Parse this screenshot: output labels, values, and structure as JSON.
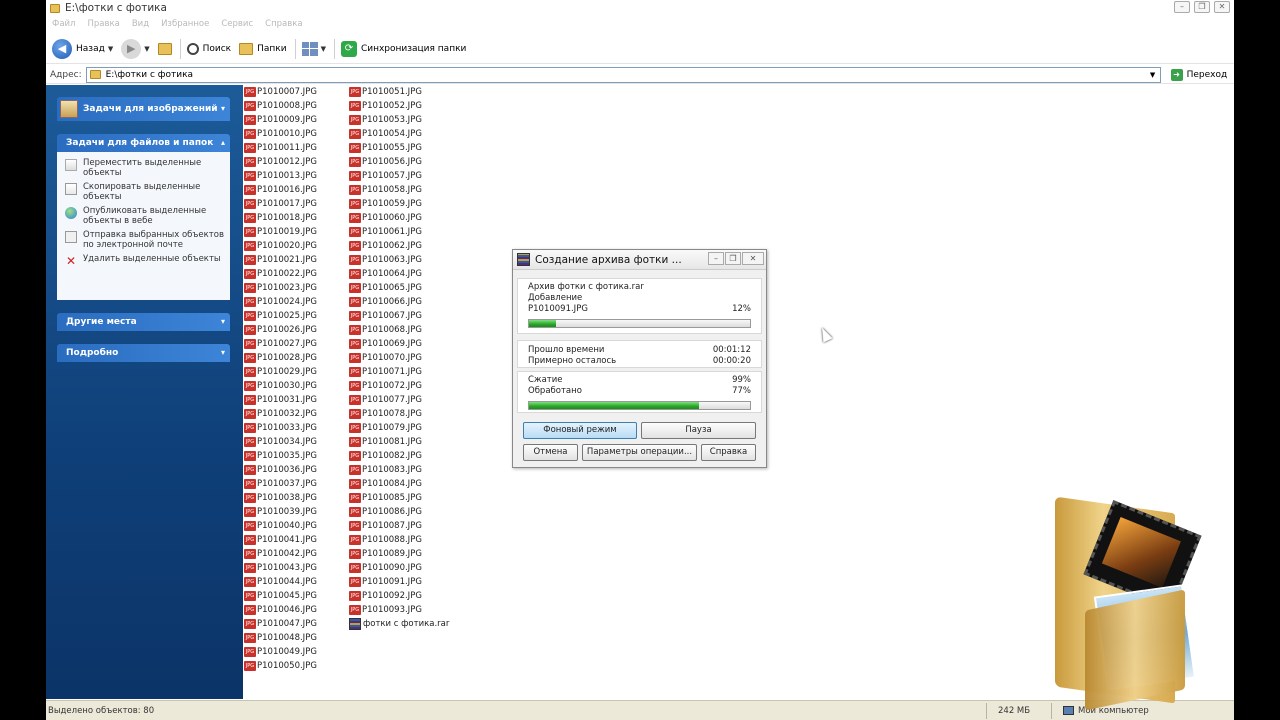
{
  "window": {
    "title": "E:\\фотки с фотика"
  },
  "menu": [
    "Файл",
    "Правка",
    "Вид",
    "Избранное",
    "Сервис",
    "Справка"
  ],
  "toolbar": {
    "back_label": "Назад",
    "search_label": "Поиск",
    "folders_label": "Папки",
    "sync_label": "Синхронизация папки"
  },
  "address": {
    "label": "Адрес:",
    "value": "E:\\фотки с фотика",
    "go_label": "Переход"
  },
  "taskpane": {
    "image_tasks": "Задачи для изображений",
    "file_tasks": "Задачи для файлов и папок",
    "tasks": [
      "Переместить выделенные объекты",
      "Скопировать выделенные объекты",
      "Опубликовать выделенные объекты в вебе",
      "Отправка выбранных объектов по электронной почте",
      "Удалить выделенные объекты"
    ],
    "other_places": "Другие места",
    "details": "Подробно"
  },
  "files": {
    "col1": [
      "P1010007.JPG",
      "P1010008.JPG",
      "P1010009.JPG",
      "P1010010.JPG",
      "P1010011.JPG",
      "P1010012.JPG",
      "P1010013.JPG",
      "P1010016.JPG",
      "P1010017.JPG",
      "P1010018.JPG",
      "P1010019.JPG",
      "P1010020.JPG",
      "P1010021.JPG",
      "P1010022.JPG",
      "P1010023.JPG",
      "P1010024.JPG",
      "P1010025.JPG",
      "P1010026.JPG",
      "P1010027.JPG",
      "P1010028.JPG",
      "P1010029.JPG",
      "P1010030.JPG",
      "P1010031.JPG",
      "P1010032.JPG",
      "P1010033.JPG",
      "P1010034.JPG",
      "P1010035.JPG",
      "P1010036.JPG",
      "P1010037.JPG",
      "P1010038.JPG",
      "P1010039.JPG",
      "P1010040.JPG",
      "P1010041.JPG",
      "P1010042.JPG",
      "P1010043.JPG",
      "P1010044.JPG",
      "P1010045.JPG",
      "P1010046.JPG",
      "P1010047.JPG",
      "P1010048.JPG",
      "P1010049.JPG",
      "P1010050.JPG"
    ],
    "col2": [
      "P1010051.JPG",
      "P1010052.JPG",
      "P1010053.JPG",
      "P1010054.JPG",
      "P1010055.JPG",
      "P1010056.JPG",
      "P1010057.JPG",
      "P1010058.JPG",
      "P1010059.JPG",
      "P1010060.JPG",
      "P1010061.JPG",
      "P1010062.JPG",
      "P1010063.JPG",
      "P1010064.JPG",
      "P1010065.JPG",
      "P1010066.JPG",
      "P1010067.JPG",
      "P1010068.JPG",
      "P1010069.JPG",
      "P1010070.JPG",
      "P1010071.JPG",
      "P1010072.JPG",
      "P1010077.JPG",
      "P1010078.JPG",
      "P1010079.JPG",
      "P1010081.JPG",
      "P1010082.JPG",
      "P1010083.JPG",
      "P1010084.JPG",
      "P1010085.JPG",
      "P1010086.JPG",
      "P1010087.JPG",
      "P1010088.JPG",
      "P1010089.JPG",
      "P1010090.JPG",
      "P1010091.JPG",
      "P1010092.JPG",
      "P1010093.JPG"
    ],
    "rar": "фотки с фотика.rar",
    "jpg_badge": "JPG"
  },
  "status": {
    "selected": "Выделено объектов: 80",
    "size": "242 МБ",
    "location": "Мой компьютер"
  },
  "dialog": {
    "title": "Создание архива фотки ...",
    "archive": "Архив фотки с фотика.rar",
    "action": "Добавление",
    "current_file": "P1010091.JPG",
    "file_percent": "12%",
    "file_progress": 0.12,
    "elapsed_label": "Прошло времени",
    "elapsed": "00:01:12",
    "remaining_label": "Примерно осталось",
    "remaining": "00:00:20",
    "ratio_label": "Сжатие",
    "ratio": "99%",
    "processed_label": "Обработано",
    "processed": "77%",
    "processed_progress": 0.77,
    "btn_background": "Фоновый режим",
    "btn_pause": "Пауза",
    "btn_cancel": "Отмена",
    "btn_params": "Параметры операции...",
    "btn_help": "Справка"
  }
}
